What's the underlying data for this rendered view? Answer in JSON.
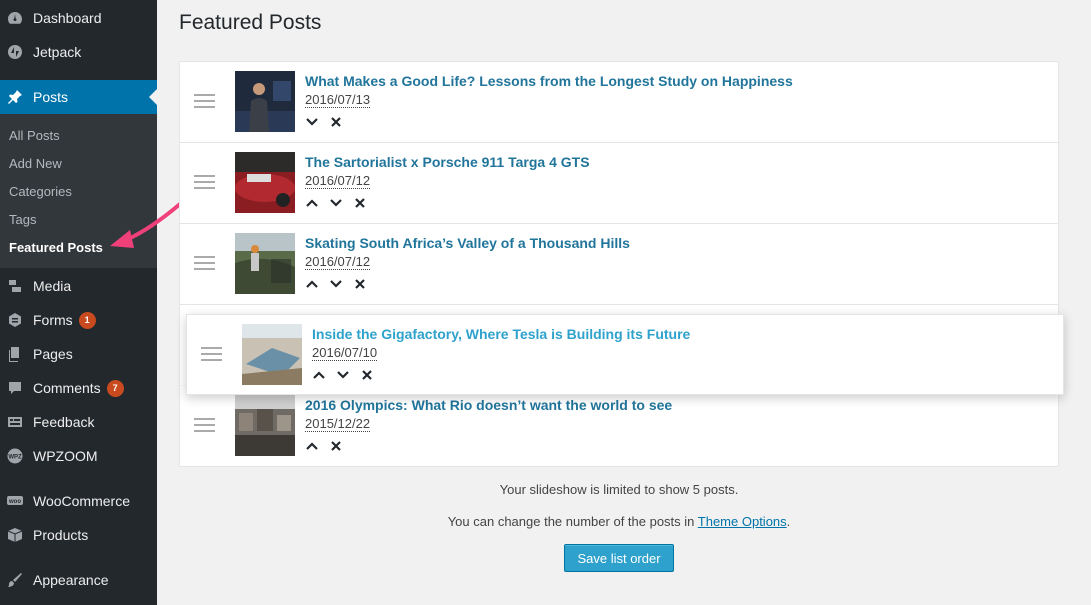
{
  "sidebar": {
    "menu": [
      {
        "label": "Dashboard",
        "icon": "dashboard-icon"
      },
      {
        "label": "Jetpack",
        "icon": "jetpack-icon"
      },
      {
        "label": "Posts",
        "icon": "pin-icon"
      },
      {
        "label": "Media",
        "icon": "media-icon"
      },
      {
        "label": "Forms",
        "icon": "forms-icon",
        "badge": "1"
      },
      {
        "label": "Pages",
        "icon": "pages-icon"
      },
      {
        "label": "Comments",
        "icon": "comment-icon",
        "badge": "7"
      },
      {
        "label": "Feedback",
        "icon": "feedback-icon"
      },
      {
        "label": "WPZOOM",
        "icon": "wpzoom-icon"
      },
      {
        "label": "WooCommerce",
        "icon": "woocommerce-icon"
      },
      {
        "label": "Products",
        "icon": "products-icon"
      },
      {
        "label": "Appearance",
        "icon": "appearance-icon"
      }
    ],
    "submenu": [
      "All Posts",
      "Add New",
      "Categories",
      "Tags",
      "Featured Posts"
    ]
  },
  "main": {
    "title": "Featured Posts",
    "posts": [
      {
        "title": "What Makes a Good Life? Lessons from the Longest Study on Happiness",
        "date": "2016/07/13"
      },
      {
        "title": "The Sartorialist x Porsche 911 Targa 4 GTS",
        "date": "2016/07/12"
      },
      {
        "title": "Skating South Africa’s Valley of a Thousand Hills",
        "date": "2016/07/12"
      },
      {
        "title": "Inside the Gigafactory, Where Tesla is Building its Future",
        "date": "2016/07/10"
      },
      {
        "title": "2016 Olympics: What Rio doesn’t want the world to see",
        "date": "2015/12/22"
      }
    ],
    "limit_note": "Your slideshow is limited to show 5 posts.",
    "change_note_prefix": "You can change the number of the posts in ",
    "change_note_link": "Theme Options",
    "change_note_suffix": ".",
    "save_label": "Save list order"
  },
  "colors": {
    "sidebar_bg": "#23282d",
    "active": "#0073aa",
    "link": "#21759b",
    "button": "#2ea2cc",
    "arrow": "#f0407a"
  }
}
